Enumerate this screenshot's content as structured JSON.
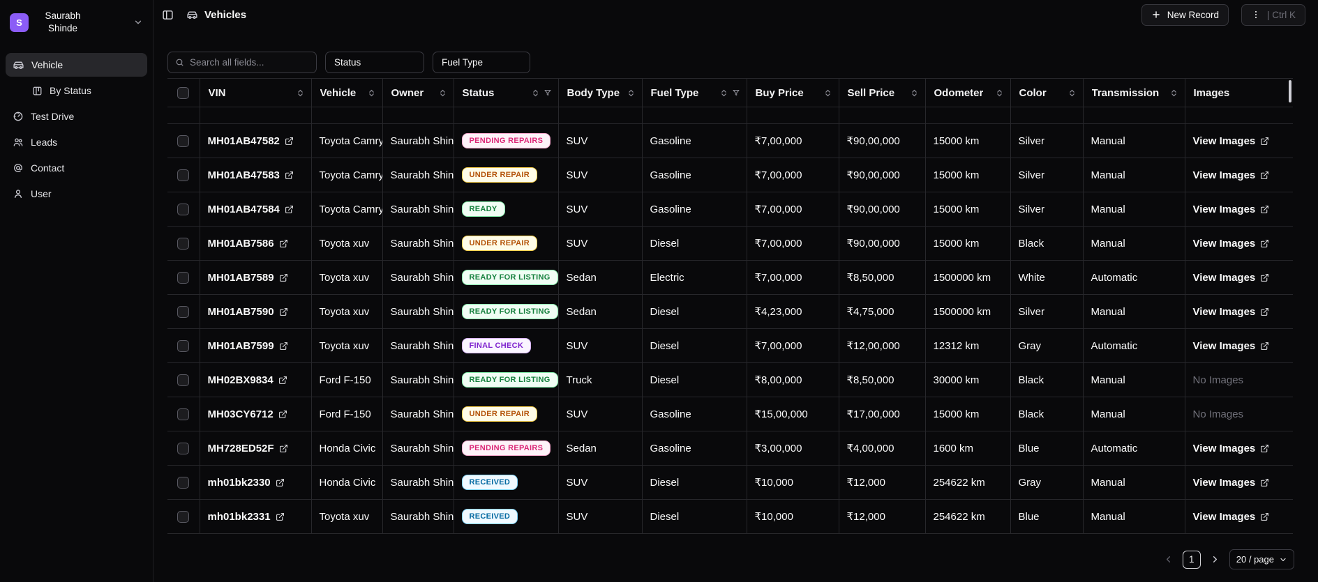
{
  "sidebar": {
    "user": {
      "initial": "S",
      "name": "Saurabh Shinde"
    },
    "items": [
      {
        "label": "Vehicle"
      },
      {
        "label": "By Status"
      },
      {
        "label": "Test Drive"
      },
      {
        "label": "Leads"
      },
      {
        "label": "Contact"
      },
      {
        "label": "User"
      }
    ]
  },
  "header": {
    "title": "Vehicles",
    "new_record_label": "New Record",
    "shortcut_label": "| Ctrl K"
  },
  "filters": {
    "search_placeholder": "Search all fields...",
    "status_label": "Status",
    "fuel_label": "Fuel Type"
  },
  "table": {
    "columns": [
      {
        "label": "VIN",
        "sortable": true,
        "filter": false
      },
      {
        "label": "Vehicle",
        "sortable": true,
        "filter": false
      },
      {
        "label": "Owner",
        "sortable": true,
        "filter": false
      },
      {
        "label": "Status",
        "sortable": true,
        "filter": true
      },
      {
        "label": "Body Type",
        "sortable": true,
        "filter": false
      },
      {
        "label": "Fuel Type",
        "sortable": true,
        "filter": true
      },
      {
        "label": "Buy Price",
        "sortable": true,
        "filter": false
      },
      {
        "label": "Sell Price",
        "sortable": true,
        "filter": false
      },
      {
        "label": "Odometer",
        "sortable": true,
        "filter": false
      },
      {
        "label": "Color",
        "sortable": true,
        "filter": false
      },
      {
        "label": "Transmission",
        "sortable": true,
        "filter": false
      },
      {
        "label": "Images",
        "sortable": false,
        "filter": false
      }
    ],
    "rows": [
      {
        "vin": "MH01AB47582",
        "vehicle": "Toyota Camry",
        "owner": "Saurabh Shinde",
        "status": "PENDING REPAIRS",
        "status_type": "pending",
        "body_type": "SUV",
        "fuel_type": "Gasoline",
        "buy_price": "₹7,00,000",
        "sell_price": "₹90,00,000",
        "odometer": "15000 km",
        "color": "Silver",
        "transmission": "Manual",
        "images": "View Images"
      },
      {
        "vin": "MH01AB47583",
        "vehicle": "Toyota Camry",
        "owner": "Saurabh Shinde",
        "status": "UNDER REPAIR",
        "status_type": "repair",
        "body_type": "SUV",
        "fuel_type": "Gasoline",
        "buy_price": "₹7,00,000",
        "sell_price": "₹90,00,000",
        "odometer": "15000 km",
        "color": "Silver",
        "transmission": "Manual",
        "images": "View Images"
      },
      {
        "vin": "MH01AB47584",
        "vehicle": "Toyota Camry",
        "owner": "Saurabh Shinde",
        "status": "READY",
        "status_type": "ready",
        "body_type": "SUV",
        "fuel_type": "Gasoline",
        "buy_price": "₹7,00,000",
        "sell_price": "₹90,00,000",
        "odometer": "15000 km",
        "color": "Silver",
        "transmission": "Manual",
        "images": "View Images"
      },
      {
        "vin": "MH01AB7586",
        "vehicle": "Toyota xuv",
        "owner": "Saurabh Shinde",
        "status": "UNDER REPAIR",
        "status_type": "repair",
        "body_type": "SUV",
        "fuel_type": "Diesel",
        "buy_price": "₹7,00,000",
        "sell_price": "₹90,00,000",
        "odometer": "15000 km",
        "color": "Black",
        "transmission": "Manual",
        "images": "View Images"
      },
      {
        "vin": "MH01AB7589",
        "vehicle": "Toyota xuv",
        "owner": "Saurabh Shinde",
        "status": "READY FOR LISTING",
        "status_type": "ready",
        "body_type": "Sedan",
        "fuel_type": "Electric",
        "buy_price": "₹7,00,000",
        "sell_price": "₹8,50,000",
        "odometer": "1500000 km",
        "color": "White",
        "transmission": "Automatic",
        "images": "View Images"
      },
      {
        "vin": "MH01AB7590",
        "vehicle": "Toyota xuv",
        "owner": "Saurabh Shinde",
        "status": "READY FOR LISTING",
        "status_type": "ready",
        "body_type": "Sedan",
        "fuel_type": "Diesel",
        "buy_price": "₹4,23,000",
        "sell_price": "₹4,75,000",
        "odometer": "1500000 km",
        "color": "Silver",
        "transmission": "Manual",
        "images": "View Images"
      },
      {
        "vin": "MH01AB7599",
        "vehicle": "Toyota xuv",
        "owner": "Saurabh Shinde",
        "status": "FINAL CHECK",
        "status_type": "final",
        "body_type": "SUV",
        "fuel_type": "Diesel",
        "buy_price": "₹7,00,000",
        "sell_price": "₹12,00,000",
        "odometer": "12312 km",
        "color": "Gray",
        "transmission": "Automatic",
        "images": "View Images"
      },
      {
        "vin": "MH02BX9834",
        "vehicle": "Ford F-150",
        "owner": "Saurabh Shinde",
        "status": "READY FOR LISTING",
        "status_type": "ready",
        "body_type": "Truck",
        "fuel_type": "Diesel",
        "buy_price": "₹8,00,000",
        "sell_price": "₹8,50,000",
        "odometer": "30000 km",
        "color": "Black",
        "transmission": "Manual",
        "images": "No Images"
      },
      {
        "vin": "MH03CY6712",
        "vehicle": "Ford F-150",
        "owner": "Saurabh Shinde",
        "status": "UNDER REPAIR",
        "status_type": "repair",
        "body_type": "SUV",
        "fuel_type": "Gasoline",
        "buy_price": "₹15,00,000",
        "sell_price": "₹17,00,000",
        "odometer": "15000 km",
        "color": "Black",
        "transmission": "Manual",
        "images": "No Images"
      },
      {
        "vin": "MH728ED52F",
        "vehicle": "Honda Civic",
        "owner": "Saurabh Shinde",
        "status": "PENDING REPAIRS",
        "status_type": "pending",
        "body_type": "Sedan",
        "fuel_type": "Gasoline",
        "buy_price": "₹3,00,000",
        "sell_price": "₹4,00,000",
        "odometer": "1600 km",
        "color": "Blue",
        "transmission": "Automatic",
        "images": "View Images"
      },
      {
        "vin": "mh01bk2330",
        "vehicle": "Honda Civic",
        "owner": "Saurabh Shinde",
        "status": "RECEIVED",
        "status_type": "received",
        "body_type": "SUV",
        "fuel_type": "Diesel",
        "buy_price": "₹10,000",
        "sell_price": "₹12,000",
        "odometer": "254622 km",
        "color": "Gray",
        "transmission": "Manual",
        "images": "View Images"
      },
      {
        "vin": "mh01bk2331",
        "vehicle": "Toyota xuv",
        "owner": "Saurabh Shinde",
        "status": "RECEIVED",
        "status_type": "received",
        "body_type": "SUV",
        "fuel_type": "Diesel",
        "buy_price": "₹10,000",
        "sell_price": "₹12,000",
        "odometer": "254622 km",
        "color": "Blue",
        "transmission": "Manual",
        "images": "View Images"
      }
    ]
  },
  "status_styles": {
    "pending": {
      "text": "#db2777",
      "bg": "#fdf2f8",
      "border": "#f5a8cd"
    },
    "repair": {
      "text": "#b45309",
      "bg": "#fefce8",
      "border": "#fcd34d"
    },
    "ready": {
      "text": "#15803d",
      "bg": "#f0fdf4",
      "border": "#86efac"
    },
    "final": {
      "text": "#7e22ce",
      "bg": "#faf5ff",
      "border": "#d8b4fe"
    },
    "received": {
      "text": "#0369a1",
      "bg": "#f0f9ff",
      "border": "#7dd3fc"
    }
  },
  "pagination": {
    "current_page": "1",
    "page_size_label": "20 / page"
  }
}
